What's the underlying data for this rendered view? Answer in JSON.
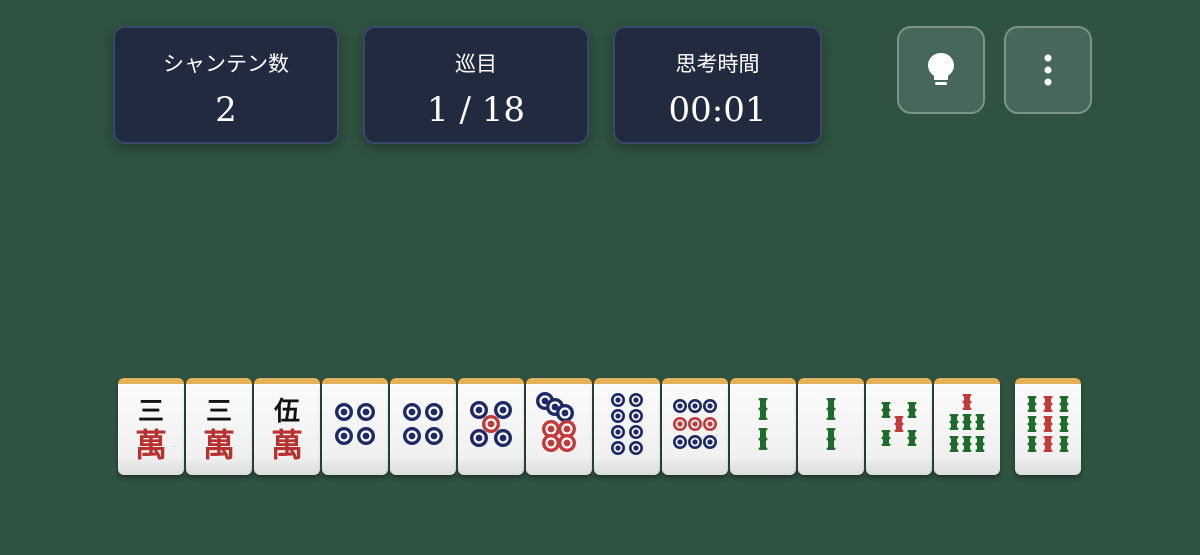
{
  "stats": {
    "shanten": {
      "label": "シャンテン数",
      "value": "2"
    },
    "turn": {
      "label": "巡目",
      "value": "1 / 18"
    },
    "time": {
      "label": "思考時間",
      "value": "00:01"
    }
  },
  "buttons": {
    "hint_icon": "lightbulb-icon",
    "menu_icon": "kebab-menu-icon"
  },
  "colors": {
    "table": "#305240",
    "panel": "#222a3f",
    "pin_blue": "#1d2a66",
    "pin_red": "#c23a3a",
    "sou_green": "#1f6b2c",
    "man_red": "#b8312f"
  },
  "hand": [
    {
      "suit": "man",
      "rank": 3,
      "glyph": "三",
      "kanji": "萬"
    },
    {
      "suit": "man",
      "rank": 3,
      "glyph": "三",
      "kanji": "萬"
    },
    {
      "suit": "man",
      "rank": 5,
      "glyph": "伍",
      "kanji": "萬"
    },
    {
      "suit": "pin",
      "rank": 4
    },
    {
      "suit": "pin",
      "rank": 4
    },
    {
      "suit": "pin",
      "rank": 5
    },
    {
      "suit": "pin",
      "rank": 7
    },
    {
      "suit": "pin",
      "rank": 8
    },
    {
      "suit": "pin",
      "rank": 9
    },
    {
      "suit": "sou",
      "rank": 2
    },
    {
      "suit": "sou",
      "rank": 2
    },
    {
      "suit": "sou",
      "rank": 5
    },
    {
      "suit": "sou",
      "rank": 7
    }
  ],
  "drawn": {
    "suit": "sou",
    "rank": 9
  }
}
